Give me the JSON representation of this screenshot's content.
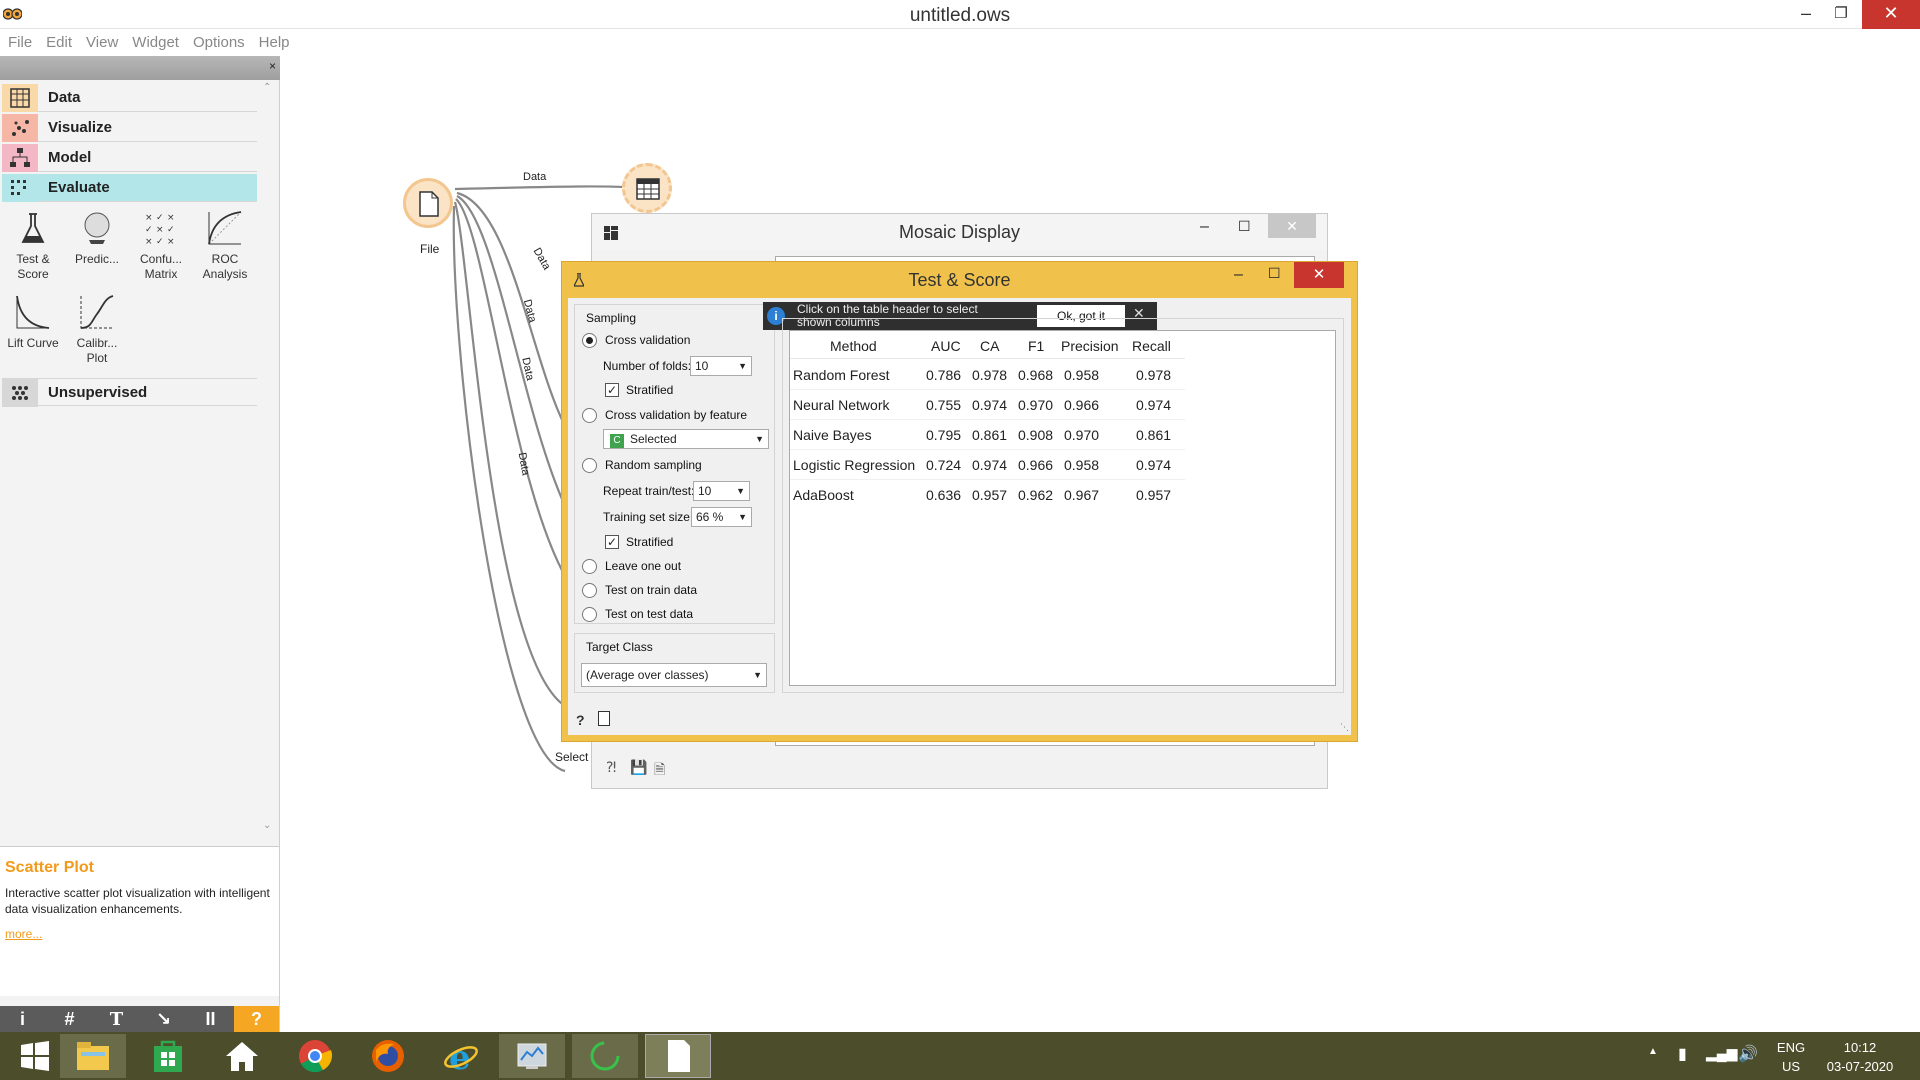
{
  "window": {
    "title": "untitled.ows"
  },
  "menu": [
    "File",
    "Edit",
    "View",
    "Widget",
    "Options",
    "Help"
  ],
  "dock": {
    "categories": [
      {
        "label": "Data",
        "color": "#f9d9a8"
      },
      {
        "label": "Visualize",
        "color": "#f6b7a6"
      },
      {
        "label": "Model",
        "color": "#f4b7c5"
      },
      {
        "label": "Evaluate",
        "color": "#b3e6e9"
      },
      {
        "label": "Unsupervised",
        "color": "#d7d7d7"
      }
    ],
    "widgets": [
      "Test & Score",
      "Predic...",
      "Confu... Matrix",
      "ROC Analysis",
      "Lift Curve",
      "Calibr... Plot"
    ],
    "description": {
      "title": "Scatter Plot",
      "text": "Interactive scatter plot visualization with intelligent data visualization enhancements.",
      "more": "more..."
    },
    "toolbar": [
      "i",
      "#",
      "T",
      "↘",
      "II",
      "?"
    ]
  },
  "canvas": {
    "file_label": "File",
    "select_label": "Select",
    "link_labels": [
      "Data",
      "Data",
      "Data",
      "Data",
      "Data"
    ]
  },
  "mosaic": {
    "title": "Mosaic Display"
  },
  "testscore": {
    "title": "Test & Score",
    "sampling": {
      "heading": "Sampling",
      "cross_validation": "Cross validation",
      "folds_label": "Number of folds:",
      "folds_value": "10",
      "stratified": "Stratified",
      "cv_by_feature": "Cross validation by feature",
      "feature_value": "Selected",
      "random_sampling": "Random sampling",
      "repeat_label": "Repeat train/test:",
      "repeat_value": "10",
      "train_size_label": "Training set size:",
      "train_size_value": "66 %",
      "stratified2": "Stratified",
      "leave_one_out": "Leave one out",
      "test_on_train": "Test on train data",
      "test_on_test": "Test on test data"
    },
    "target": {
      "heading": "Target Class",
      "value": "(Average over classes)"
    },
    "info": {
      "text": "Click on the table header to select shown columns",
      "button": "Ok, got it"
    },
    "table": {
      "headers": [
        "Method",
        "AUC",
        "CA",
        "F1",
        "Precision",
        "Recall"
      ],
      "rows": [
        [
          "Random Forest",
          "0.786",
          "0.978",
          "0.968",
          "0.958",
          "0.978"
        ],
        [
          "Neural Network",
          "0.755",
          "0.974",
          "0.970",
          "0.966",
          "0.974"
        ],
        [
          "Naive Bayes",
          "0.795",
          "0.861",
          "0.908",
          "0.970",
          "0.861"
        ],
        [
          "Logistic Regression",
          "0.724",
          "0.974",
          "0.966",
          "0.958",
          "0.974"
        ],
        [
          "AdaBoost",
          "0.636",
          "0.957",
          "0.962",
          "0.967",
          "0.957"
        ]
      ]
    }
  },
  "taskbar": {
    "lang1": "ENG",
    "lang2": "US",
    "time": "10:12",
    "date": "03-07-2020"
  }
}
